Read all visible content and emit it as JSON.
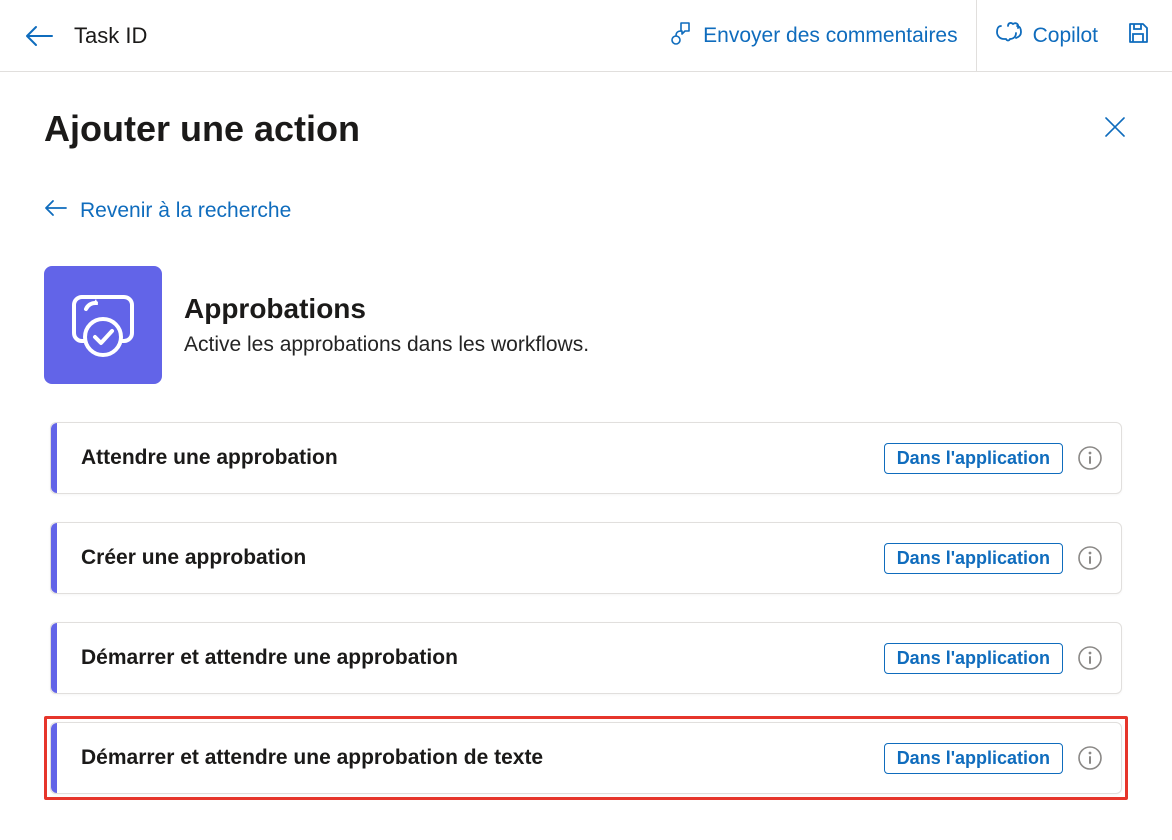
{
  "topbar": {
    "title": "Task ID",
    "feedback": "Envoyer des commentaires",
    "copilot": "Copilot"
  },
  "header": {
    "title": "Ajouter une action"
  },
  "backlink": "Revenir à la recherche",
  "connector": {
    "title": "Approbations",
    "description": "Active les approbations dans les workflows."
  },
  "badge": "Dans l'application",
  "actions": [
    {
      "label": "Attendre une approbation",
      "highlight": false
    },
    {
      "label": "Créer une approbation",
      "highlight": false
    },
    {
      "label": "Démarrer et attendre une approbation",
      "highlight": false
    },
    {
      "label": "Démarrer et attendre une approbation de texte",
      "highlight": true
    }
  ]
}
